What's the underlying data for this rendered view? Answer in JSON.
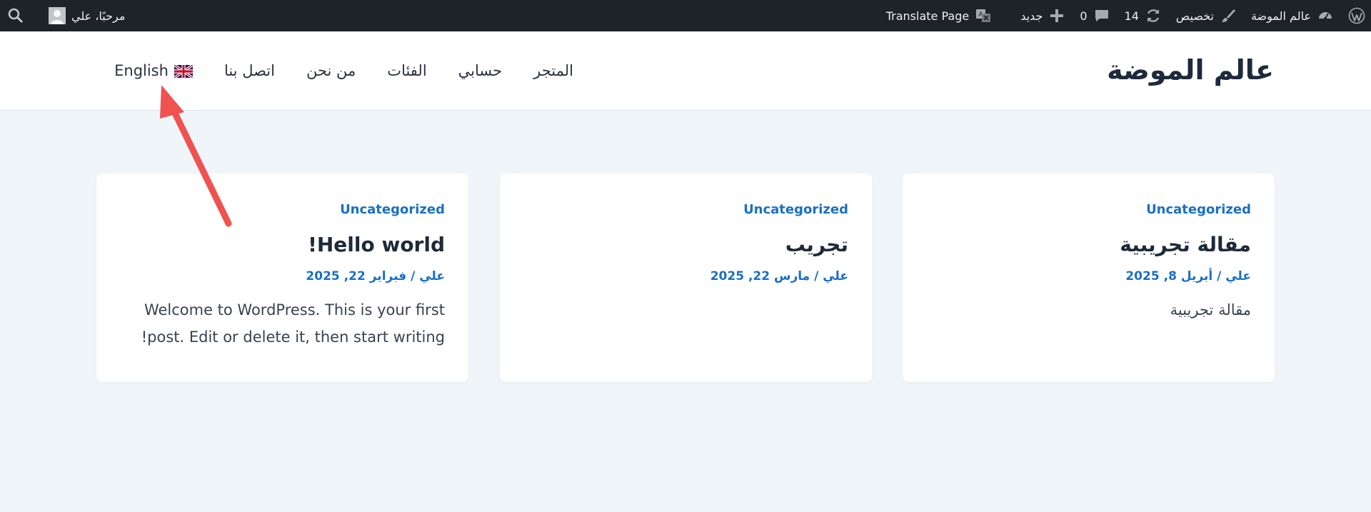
{
  "admin_bar": {
    "site_name": "عالم الموضة",
    "customize": "تخصيص",
    "updates_count": "14",
    "comments_count": "0",
    "new_label": "جديد",
    "translate_label": "Translate Page",
    "greeting": "مرحبًا، علي"
  },
  "header": {
    "site_title": "عالم الموضة",
    "nav": {
      "shop": "المتجر",
      "account": "حسابي",
      "categories": "الفئات",
      "about": "من نحن",
      "contact": "اتصل بنا",
      "language": "English"
    }
  },
  "posts": [
    {
      "category": "Uncategorized",
      "title": "مقالة تجريبية",
      "author": "علي",
      "date": "أبريل 8, 2025",
      "excerpt": "مقالة تجريبية"
    },
    {
      "category": "Uncategorized",
      "title": "تجريب",
      "author": "علي",
      "date": "مارس 22, 2025",
      "excerpt": ""
    },
    {
      "category": "Uncategorized",
      "title": "Hello world!",
      "author": "علي",
      "date": "فبراير 22, 2025",
      "excerpt": "Welcome to WordPress. This is your first post. Edit or delete it, then start writing!"
    }
  ],
  "colors": {
    "admin_bar_bg": "#1d2327",
    "link_blue": "#1a6fc4",
    "page_bg": "#f0f5fa",
    "annotation_red": "#f0524f"
  },
  "icons": [
    "wordpress-icon",
    "dashboard-icon",
    "brush-icon",
    "updates-icon",
    "comment-icon",
    "plus-icon",
    "translate-icon",
    "search-icon",
    "uk-flag-icon"
  ]
}
